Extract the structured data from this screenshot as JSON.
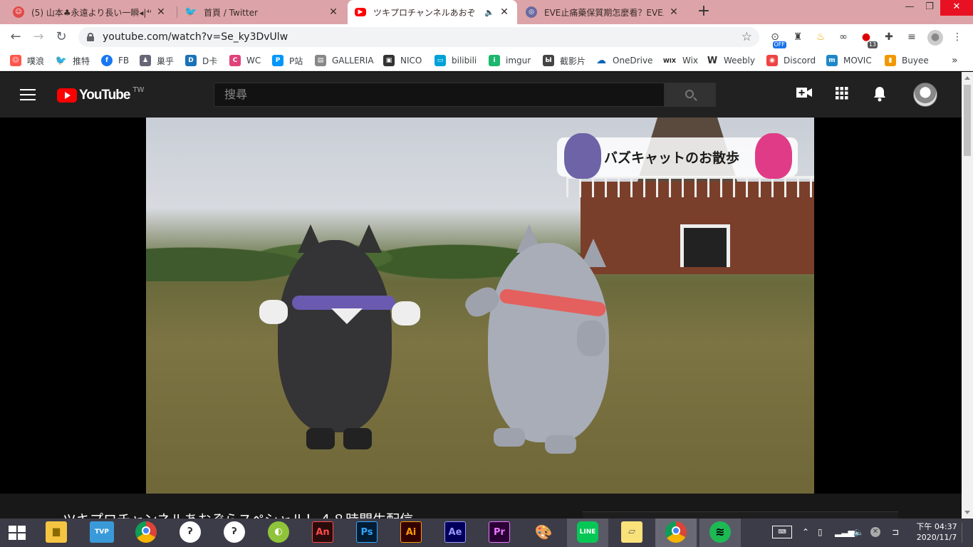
{
  "tabs": [
    {
      "title": "(5) 山本♣永遠より長い一瞬◂|⁴⁶",
      "favicon_color": "#e24a4a",
      "active": false
    },
    {
      "title": "首頁 / Twitter",
      "favicon_color": "#1da1f2",
      "active": false
    },
    {
      "title": "ツキプロチャンネルあおぞ",
      "favicon_color": "#ff0000",
      "active": true
    },
    {
      "title": "EVE止痛藥保質期怎麼看？EVE止",
      "favicon_color": "#6a6aa0",
      "active": false
    }
  ],
  "tab_close_glyph": "✕",
  "new_tab_glyph": "+",
  "window_controls": {
    "minimize": "—",
    "restore": "❐",
    "close": "✕"
  },
  "nav": {
    "back": "←",
    "forward": "→",
    "reload": "↻"
  },
  "url": "youtube.com/watch?v=Se_ky3DvUlw",
  "bookmark_star": "☆",
  "extensions": [
    {
      "name": "off-extension",
      "badge": "OFF",
      "badge_color": "#1a73e8"
    },
    {
      "name": "spy-extension",
      "badge": ""
    },
    {
      "name": "bell-extension",
      "badge": ""
    },
    {
      "name": "link-extension",
      "badge": ""
    },
    {
      "name": "red-extension",
      "badge": "13",
      "badge_color": "#555"
    },
    {
      "name": "puzzle-extension",
      "badge": ""
    },
    {
      "name": "media-extension",
      "badge": ""
    },
    {
      "name": "profile",
      "badge": ""
    }
  ],
  "bookmarks": [
    {
      "label": "噗浪",
      "color": "#ff574d"
    },
    {
      "label": "推特",
      "color": "#1da1f2"
    },
    {
      "label": "FB",
      "color": "#1877f2"
    },
    {
      "label": "巢乎",
      "color": "#667"
    },
    {
      "label": "D卡",
      "color": "#1a73b8"
    },
    {
      "label": "WC",
      "color": "#e0427a"
    },
    {
      "label": "P站",
      "color": "#0096fa"
    },
    {
      "label": "GALLERIA",
      "color": "#888"
    },
    {
      "label": "NICO",
      "color": "#333"
    },
    {
      "label": "bilibili",
      "color": "#00a1d6"
    },
    {
      "label": "imgur",
      "color": "#1bb76e"
    },
    {
      "label": "截影片",
      "color": "#444"
    },
    {
      "label": "OneDrive",
      "color": "#0364b8"
    },
    {
      "label": "Wix",
      "color": "#222"
    },
    {
      "label": "Weebly",
      "color": "#333"
    },
    {
      "label": "Discord",
      "color": "#e44"
    },
    {
      "label": "MOVIC",
      "color": "#1e88c8"
    },
    {
      "label": "Buyee",
      "color": "#f39800"
    }
  ],
  "bookmarks_overflow": "»",
  "youtube": {
    "logo_text": "YouTube",
    "region": "TW",
    "search_placeholder": "搜尋",
    "create_icon": "create-video-icon",
    "apps_icon": "apps-grid-icon",
    "notifications_icon": "bell-icon"
  },
  "video": {
    "overlay_text": "バズキャットのお散歩",
    "title": "ツキプロチャンネルあおぞらスペシャル！４８時間生配信"
  },
  "taskbar": {
    "apps": [
      "File Explorer",
      "TVP",
      "Chrome",
      "Clip Studio",
      "Clip Studio",
      "Tennis",
      "An",
      "Ps",
      "Ai",
      "Ae",
      "Pr",
      "Paint",
      "LINE",
      "Sticky Notes",
      "Chrome",
      "Spotify"
    ],
    "clock_time": "下午 04:37",
    "clock_date": "2020/11/7"
  }
}
